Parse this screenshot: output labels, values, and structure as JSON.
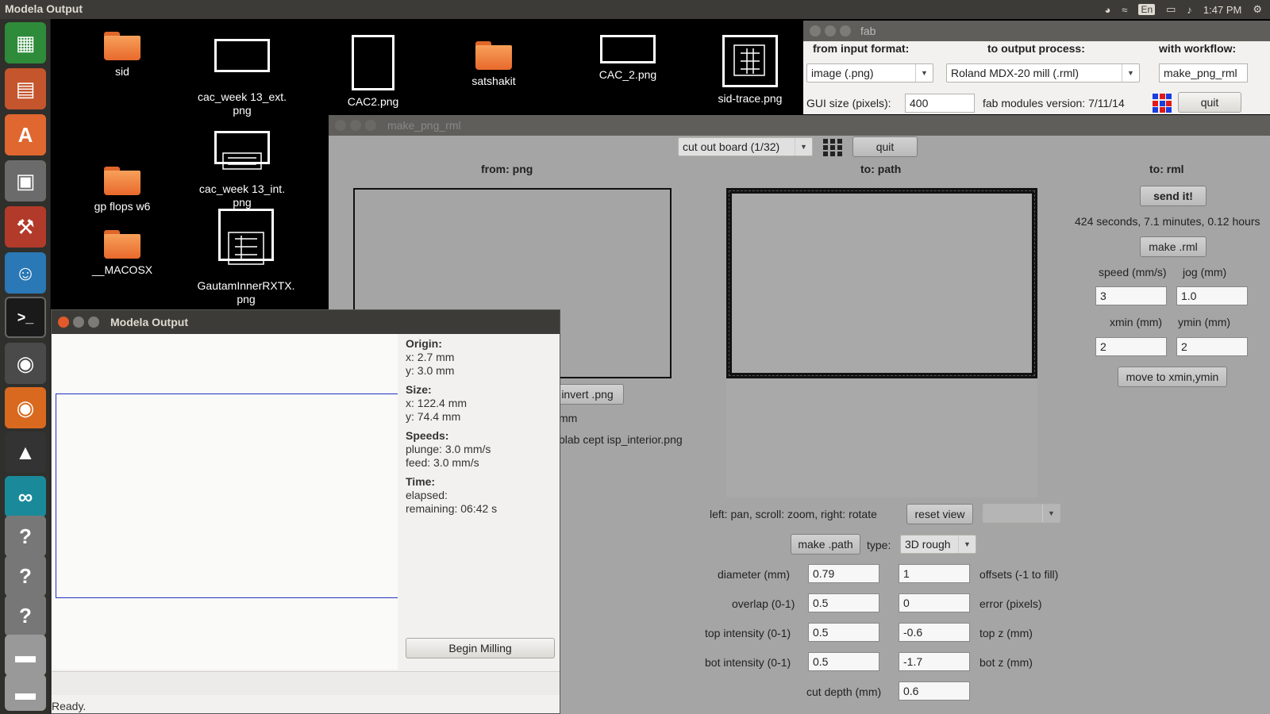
{
  "topbar": {
    "title": "Modela Output",
    "keyboard": "En",
    "time": "1:47 PM",
    "icons": [
      "network-icon",
      "wifi-icon",
      "keyboard-icon",
      "battery-icon",
      "volume-icon",
      "settings-icon"
    ]
  },
  "launcher": [
    "spreadsheet-icon",
    "presentation-icon",
    "software-center-icon",
    "files-icon",
    "system-settings-icon",
    "empathy-icon",
    "terminal-icon",
    "gimp-icon",
    "firefox-icon",
    "inkscape-icon",
    "arduino-icon",
    "unknown-icon",
    "unknown-icon",
    "unknown-icon",
    "drive-icon",
    "drive-icon",
    "usb-icon"
  ],
  "desktop": {
    "sid": "sid",
    "cac_ext": "cac_week 13_ext.\npng",
    "cac2": "CAC2.png",
    "satshakit": "satshakit",
    "cac_2": "CAC_2.png",
    "sid_trace": "sid-trace.png",
    "gp_flops": "gp flops w6",
    "cac_int": "cac_week 13_int.\npng",
    "macosx": "__MACOSX",
    "gautam": "GautamInnerRXTX.\npng"
  },
  "fab": {
    "title": "fab",
    "from_label": "from input format:",
    "to_label": "to output process:",
    "workflow_label": "with workflow:",
    "input_format": "image (.png)",
    "output_process": "Roland MDX-20 mill (.rml)",
    "workflow": "make_png_rml",
    "gui_size_label": "GUI size (pixels):",
    "gui_size": "400",
    "version": "fab modules version: 7/11/14",
    "quit": "quit"
  },
  "mpr": {
    "title": "make_png_rml",
    "process": "cut out board (1/32)",
    "quit": "quit",
    "from_png": "from: png",
    "to_path": "to: path",
    "to_rml": "to: rml",
    "invert": "invert .png",
    "mm": "mm",
    "filename": "blab cept isp_interior.png",
    "send": "send it!",
    "time": "424 seconds, 7.1 minutes, 0.12 hours",
    "make_rml": "make .rml",
    "speed_label": "speed (mm/s)",
    "jog_label": "jog (mm)",
    "speed": "3",
    "jog": "1.0",
    "xmin_label": "xmin (mm)",
    "ymin_label": "ymin (mm)",
    "xmin": "2",
    "ymin": "2",
    "move": "move to xmin,ymin",
    "view_hint": "left: pan, scroll: zoom, right: rotate",
    "reset_view": "reset view",
    "make_path": "make .path",
    "type_label": "type:",
    "type": "3D rough",
    "diameter_label": "diameter (mm)",
    "diameter": "0.79",
    "offsets": "1",
    "offsets_label": "offsets (-1 to fill)",
    "overlap_label": "overlap (0-1)",
    "overlap": "0.5",
    "error": "0",
    "error_label": "error (pixels)",
    "top_int_label": "top intensity (0-1)",
    "top_int": "0.5",
    "top_z": "-0.6",
    "top_z_label": "top z (mm)",
    "bot_int_label": "bot intensity (0-1)",
    "bot_int": "0.5",
    "bot_z": "-1.7",
    "bot_z_label": "bot z (mm)",
    "cut_depth_label": "cut depth (mm)",
    "cut_depth": "0.6"
  },
  "modela": {
    "title": "Modela Output",
    "origin_h": "Origin:",
    "origin_x": "x: 2.7 mm",
    "origin_y": "y: 3.0 mm",
    "size_h": "Size:",
    "size_x": "x: 122.4 mm",
    "size_y": "y: 74.4 mm",
    "speeds_h": "Speeds:",
    "plunge": "plunge: 3.0 mm/s",
    "feed": "feed: 3.0 mm/s",
    "time_h": "Time:",
    "elapsed": "elapsed:",
    "remaining": "remaining: 06:42 s",
    "begin": "Begin Milling",
    "status": "Ready."
  }
}
